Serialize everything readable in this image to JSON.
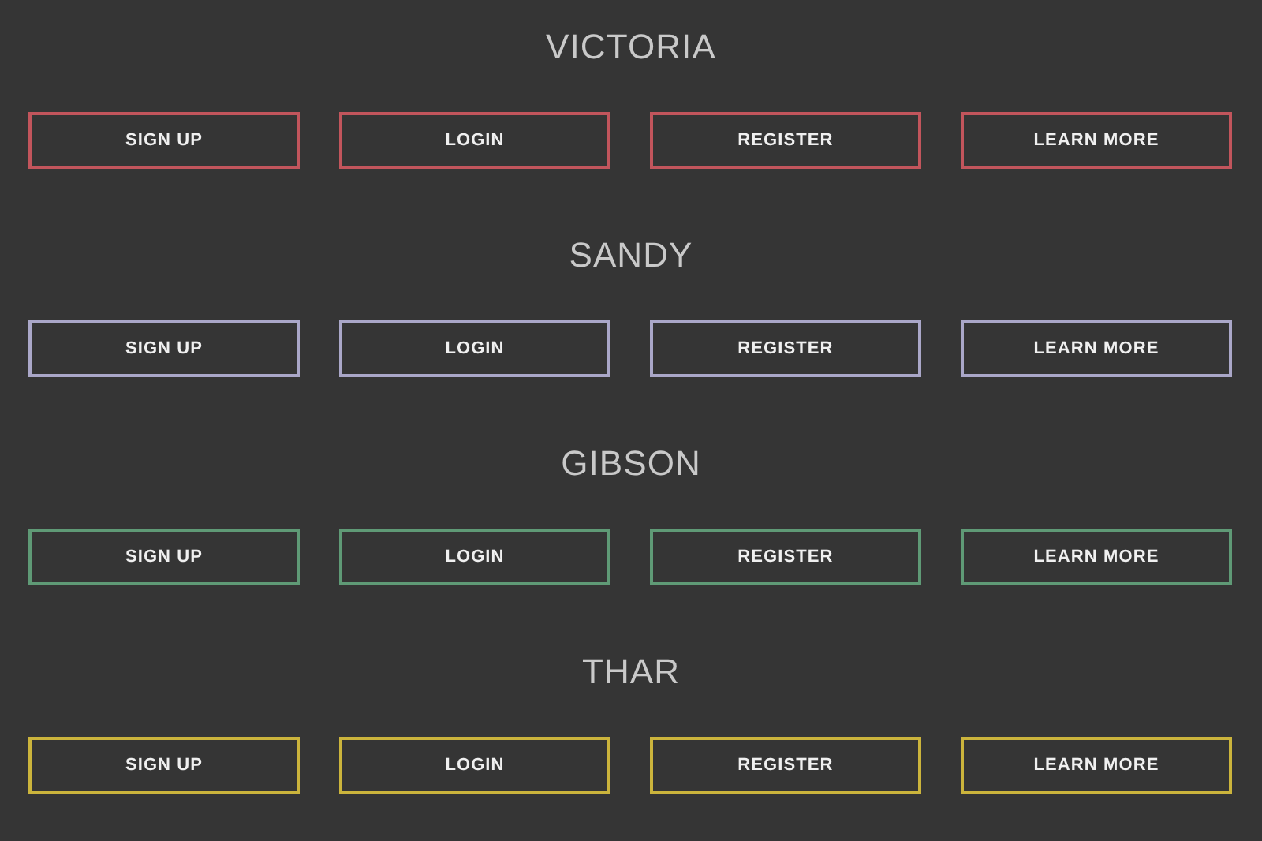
{
  "groups": [
    {
      "title": "VICTORIA",
      "color": "#c2555c",
      "buttons": [
        "SIGN UP",
        "LOGIN",
        "REGISTER",
        "LEARN MORE"
      ]
    },
    {
      "title": "SANDY",
      "color": "#aaa7c8",
      "buttons": [
        "SIGN UP",
        "LOGIN",
        "REGISTER",
        "LEARN MORE"
      ]
    },
    {
      "title": "GIBSON",
      "color": "#5f9a76",
      "buttons": [
        "SIGN UP",
        "LOGIN",
        "REGISTER",
        "LEARN MORE"
      ]
    },
    {
      "title": "THAR",
      "color": "#cbb43c",
      "buttons": [
        "SIGN UP",
        "LOGIN",
        "REGISTER",
        "LEARN MORE"
      ]
    }
  ]
}
